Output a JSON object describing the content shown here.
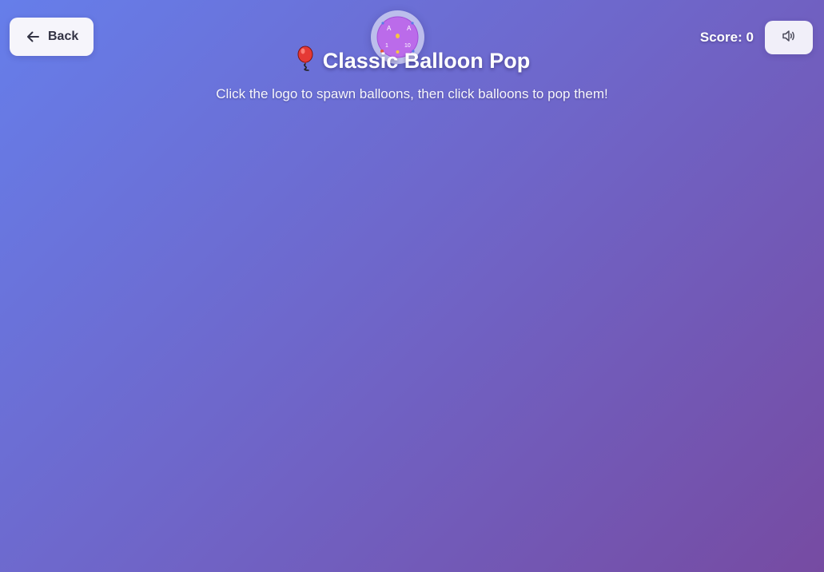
{
  "header": {
    "back_label": "Back",
    "back_icon": "arrow-left-icon",
    "title": "Classic Balloon Pop",
    "title_icon": "balloon-icon",
    "subtitle": "Click the logo to spawn balloons, then click balloons to pop them!",
    "score_label": "Score:",
    "score_value": 0,
    "sound_icon": "speaker-volume-icon"
  },
  "logo": {
    "icon": "balloon-spawner-logo-icon",
    "labels": [
      "A",
      "A",
      "1",
      "10"
    ]
  },
  "colors": {
    "background_start": "#667eea",
    "background_end": "#764ba2",
    "button_bg": "#f6f5fb",
    "logo_fill": "#b968e8",
    "balloon_red": "#e53935"
  }
}
